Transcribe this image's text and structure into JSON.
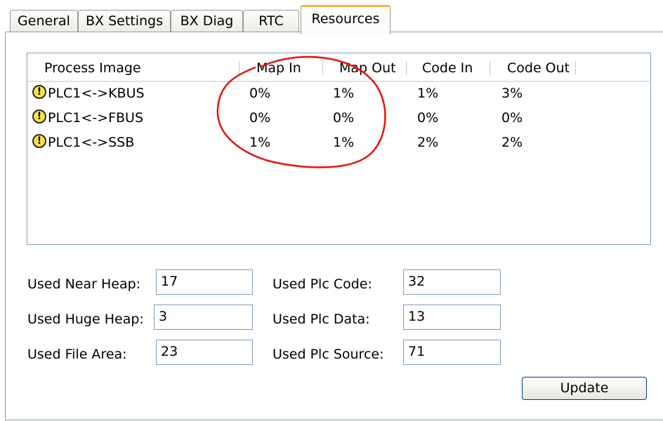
{
  "tabs": [
    "General",
    "BX Settings",
    "BX Diag",
    "RTC",
    "Resources"
  ],
  "active_tab": "Resources",
  "list": {
    "columns": [
      "Process Image",
      "Map In",
      "Map Out",
      "Code In",
      "Code Out"
    ],
    "rows": [
      {
        "name": "PLC1<->KBUS",
        "map_in": "0%",
        "map_out": "1%",
        "code_in": "1%",
        "code_out": "3%",
        "icon": "warning-icon"
      },
      {
        "name": "PLC1<->FBUS",
        "map_in": "0%",
        "map_out": "0%",
        "code_in": "0%",
        "code_out": "0%",
        "icon": "warning-icon"
      },
      {
        "name": "PLC1<->SSB",
        "map_in": "1%",
        "map_out": "1%",
        "code_in": "2%",
        "code_out": "2%",
        "icon": "warning-icon"
      }
    ],
    "warning_glyph": "!"
  },
  "fields": {
    "near_heap": {
      "label": "Used Near Heap:",
      "value": "17"
    },
    "huge_heap": {
      "label": "Used Huge Heap:",
      "value": "3"
    },
    "file_area": {
      "label": "Used File Area:",
      "value": "23"
    },
    "plc_code": {
      "label": "Used Plc Code:",
      "value": "32"
    },
    "plc_data": {
      "label": "Used Plc Data:",
      "value": "13"
    },
    "plc_source": {
      "label": "Used Plc Source:",
      "value": "71"
    }
  },
  "update_label": "Update",
  "colors": {
    "annotation": "#e8120c",
    "tab_highlight": "#f2b43c",
    "border": "#7f9db9"
  }
}
